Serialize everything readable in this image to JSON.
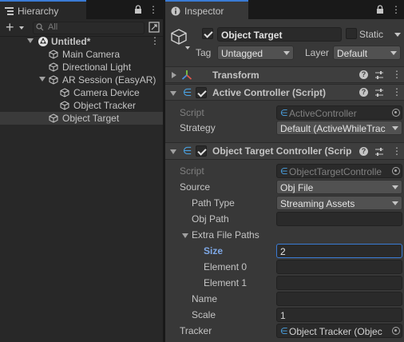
{
  "colors": {
    "accent": "#3a7bd5",
    "focus_label": "#7ea8e6",
    "panel_bg": "#383838",
    "hierarchy_bg": "#282828"
  },
  "hierarchy": {
    "tab_label": "Hierarchy",
    "search_placeholder": "All",
    "scene_name": "Untitled*",
    "items": [
      {
        "label": "Main Camera"
      },
      {
        "label": "Directional Light"
      },
      {
        "label": "AR Session (EasyAR)"
      },
      {
        "label": "Camera Device"
      },
      {
        "label": "Object Tracker"
      },
      {
        "label": "Object Target",
        "selected": true
      }
    ]
  },
  "inspector": {
    "tab_label": "Inspector",
    "object": {
      "name": "Object Target",
      "active": true,
      "static_label": "Static",
      "tag_label": "Tag",
      "tag_value": "Untagged",
      "layer_label": "Layer",
      "layer_value": "Default"
    },
    "transform": {
      "title": "Transform"
    },
    "active_controller": {
      "title": "Active Controller (Script)",
      "enabled": true,
      "script_label": "Script",
      "script_value": "ActiveController",
      "strategy_label": "Strategy",
      "strategy_value": "Default (ActiveWhileTrac"
    },
    "target_controller": {
      "title": "Object Target Controller (Scrip",
      "enabled": true,
      "script_label": "Script",
      "script_value": "ObjectTargetControlle",
      "source_label": "Source",
      "source_value": "Obj File",
      "path_type_label": "Path Type",
      "path_type_value": "Streaming Assets",
      "obj_path_label": "Obj Path",
      "obj_path_value": "",
      "extra_label": "Extra File Paths",
      "size_label": "Size",
      "size_value": "2",
      "element0_label": "Element 0",
      "element0_value": "",
      "element1_label": "Element 1",
      "element1_value": "",
      "name_label": "Name",
      "name_value": "",
      "scale_label": "Scale",
      "scale_value": "1",
      "tracker_label": "Tracker",
      "tracker_value": "Object Tracker (Objec"
    }
  }
}
